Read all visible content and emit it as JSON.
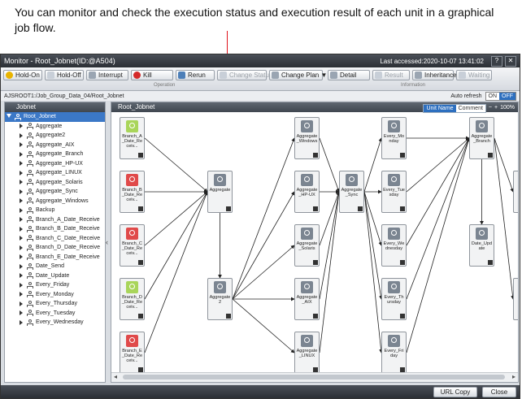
{
  "caption": "You can monitor and check the execution status and execution result of each unit in a graphical job flow.",
  "window": {
    "title": "Monitor - Root_Jobnet(ID:@A504)",
    "last_accessed": "Last accessed:2020-10-07 13:41:02",
    "help_label": "?",
    "close_label": "✕"
  },
  "toolbar": {
    "hold_on": "Hold-On",
    "hold_off": "Hold-Off",
    "interrupt": "Interrupt",
    "kill": "Kill",
    "rerun": "Rerun",
    "change_status": "Change Status",
    "change_plan": "Change Plan ▼",
    "detail": "Detail",
    "result": "Result",
    "inheritance": "Inheritance",
    "waiting": "Waiting",
    "group_operation": "Operation",
    "group_information": "Information"
  },
  "path": {
    "text": "AJSROOT1:/Job_Group_Data_04/Root_Jobnet",
    "auto_refresh_label": "Auto refresh",
    "on": "ON",
    "off": "OFF"
  },
  "left_panel": {
    "header": "Jobnet",
    "root": "Root_Jobnet",
    "items": [
      "Aggregate",
      "Aggregate2",
      "Aggregate_AIX",
      "Aggregate_Branch",
      "Aggregate_HP-UX",
      "Aggregate_LINUX",
      "Aggregate_Solaris",
      "Aggregate_Sync",
      "Aggregate_Windows",
      "Backup",
      "Branch_A_Date_Receive",
      "Branch_B_Date_Receive",
      "Branch_C_Date_Receive",
      "Branch_D_Date_Receive",
      "Branch_E_Date_Receive",
      "Date_Send",
      "Date_Update",
      "Every_Friday",
      "Every_Monday",
      "Every_Thursday",
      "Every_Tuesday",
      "Every_Wednesday"
    ]
  },
  "splitter_label": "‹",
  "right_panel": {
    "header": "Root_Jobnet",
    "unit_name": "Unit Name",
    "comment": "Comment",
    "zoom": "100%",
    "minus": "−",
    "plus": "+"
  },
  "nodes": [
    {
      "id": "bA",
      "label": "Branch_A_Date_Receiv...",
      "status": "green"
    },
    {
      "id": "bB",
      "label": "Branch_B_Date_Receiv...",
      "status": "red"
    },
    {
      "id": "bC",
      "label": "Branch_C_Date_Receiv...",
      "status": "red"
    },
    {
      "id": "bD",
      "label": "Branch_D_Date_Receiv...",
      "status": "green"
    },
    {
      "id": "bE",
      "label": "Branch_E_Date_Receiv...",
      "status": "red"
    },
    {
      "id": "agg",
      "label": "Aggregate",
      "status": "grey"
    },
    {
      "id": "agg2",
      "label": "Aggregate2",
      "status": "grey"
    },
    {
      "id": "win",
      "label": "Aggregate_Windows",
      "status": "grey"
    },
    {
      "id": "hp",
      "label": "Aggregate_HP-UX",
      "status": "grey"
    },
    {
      "id": "sol",
      "label": "Aggregate_Solaris",
      "status": "grey"
    },
    {
      "id": "aix",
      "label": "Aggregate_AIX",
      "status": "grey"
    },
    {
      "id": "lin",
      "label": "Aggregate_LINUX",
      "status": "grey"
    },
    {
      "id": "sync",
      "label": "Aggregate_Sync",
      "status": "grey"
    },
    {
      "id": "mon",
      "label": "Every_Monday",
      "status": "grey"
    },
    {
      "id": "tue",
      "label": "Every_Tuesday",
      "status": "grey"
    },
    {
      "id": "wed",
      "label": "Every_Wednesday",
      "status": "grey"
    },
    {
      "id": "thu",
      "label": "Every_Thursday",
      "status": "grey"
    },
    {
      "id": "fri",
      "label": "Every_Friday",
      "status": "grey"
    },
    {
      "id": "branch",
      "label": "Aggregate_Branch",
      "status": "grey"
    },
    {
      "id": "upd",
      "label": "Date_Update",
      "status": "grey"
    },
    {
      "id": "r1",
      "label": "",
      "status": "grey"
    },
    {
      "id": "r2",
      "label": "",
      "status": "grey"
    }
  ],
  "edges": [
    [
      "bA",
      "agg"
    ],
    [
      "bB",
      "agg"
    ],
    [
      "bC",
      "agg"
    ],
    [
      "bD",
      "agg"
    ],
    [
      "bE",
      "agg"
    ],
    [
      "agg",
      "agg2"
    ],
    [
      "agg2",
      "win"
    ],
    [
      "agg2",
      "hp"
    ],
    [
      "agg2",
      "sol"
    ],
    [
      "agg2",
      "aix"
    ],
    [
      "agg2",
      "lin"
    ],
    [
      "win",
      "sync"
    ],
    [
      "hp",
      "sync"
    ],
    [
      "sol",
      "sync"
    ],
    [
      "aix",
      "sync"
    ],
    [
      "lin",
      "sync"
    ],
    [
      "sync",
      "mon"
    ],
    [
      "sync",
      "tue"
    ],
    [
      "sync",
      "wed"
    ],
    [
      "sync",
      "thu"
    ],
    [
      "sync",
      "fri"
    ],
    [
      "mon",
      "branch"
    ],
    [
      "tue",
      "branch"
    ],
    [
      "wed",
      "branch"
    ],
    [
      "thu",
      "branch"
    ],
    [
      "fri",
      "branch"
    ],
    [
      "branch",
      "upd"
    ],
    [
      "branch",
      "r1"
    ],
    [
      "branch",
      "r2"
    ]
  ],
  "footer": {
    "url_copy": "URL Copy",
    "close": "Close"
  },
  "colors": {
    "annotation": "#e0101a",
    "selected": "#3b78c7",
    "node_red": "#e04a4a",
    "node_green": "#a9d55a"
  }
}
